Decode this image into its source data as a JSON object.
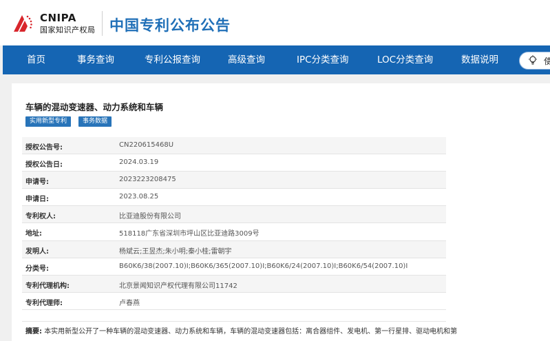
{
  "header": {
    "logo_en": "CNIPA",
    "logo_cn": "国家知识产权局",
    "site_title": "中国专利公布公告"
  },
  "nav": {
    "items": [
      "首页",
      "事务查询",
      "专利公报查询",
      "高级查询",
      "IPC分类查询",
      "LOC分类查询",
      "数据说明"
    ],
    "help_label": "使"
  },
  "patent": {
    "title": "车辆的混动变速器、动力系统和车辆",
    "tags": [
      "实用新型专利",
      "事务数据"
    ],
    "fields": [
      {
        "label": "授权公告号:",
        "value": "CN220615468U"
      },
      {
        "label": "授权公告日:",
        "value": "2024.03.19"
      },
      {
        "label": "申请号:",
        "value": "2023223208475"
      },
      {
        "label": "申请日:",
        "value": "2023.08.25"
      },
      {
        "label": "专利权人:",
        "value": "比亚迪股份有限公司"
      },
      {
        "label": "地址:",
        "value": "518118广东省深圳市坪山区比亚迪路3009号"
      },
      {
        "label": "发明人:",
        "value": "杨斌云;王昱杰;朱小明;秦小桂;雷朝宇"
      },
      {
        "label": "分类号:",
        "value": "B60K6/38(2007.10)I;B60K6/365(2007.10)I;B60K6/24(2007.10)I;B60K6/54(2007.10)I"
      },
      {
        "label": "专利代理机构:",
        "value": "北京景闻知识产权代理有限公司11742"
      },
      {
        "label": "专利代理师:",
        "value": "卢春燕"
      }
    ],
    "abstract_label": "摘要:",
    "abstract_text": "本实用新型公开了一种车辆的混动变速器、动力系统和车辆，车辆的混动变速器包括：离合器组件、发电机、第一行星排、驱动电机和第"
  },
  "colors": {
    "nav_bg": "#1565b3",
    "title_blue": "#1f6fb7",
    "tag_bg": "#2874b9",
    "logo_red": "#d8262c"
  },
  "icons": {
    "logo": "cnipa-logo-icon",
    "help": "lightbulb-icon"
  }
}
